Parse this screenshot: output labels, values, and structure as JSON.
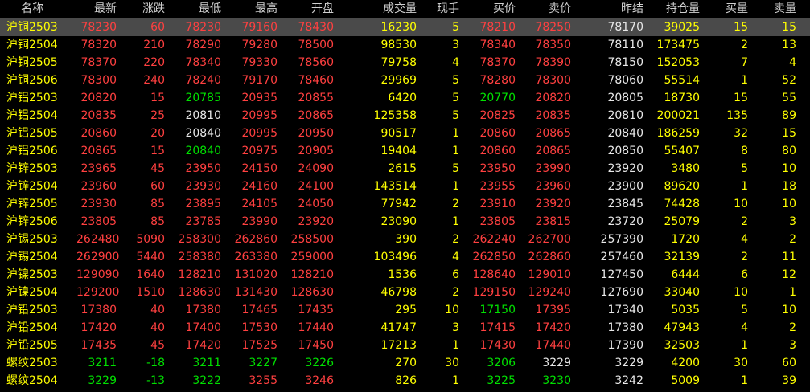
{
  "colors": {
    "red": "#ff4040",
    "green": "#00e000",
    "white": "#e8e8e8",
    "yellow": "#ffff00",
    "header": "#d0d0d0",
    "selected_row_bg": "#4a4a4a"
  },
  "headers": [
    "名称",
    "最新",
    "涨跌",
    "最低",
    "最高",
    "开盘",
    "成交量",
    "现手",
    "买价",
    "卖价",
    "昨结",
    "持仓量",
    "买量",
    "卖量"
  ],
  "rows": [
    {
      "cells": [
        "沪铜2503",
        "78230",
        "60",
        "78230",
        "79160",
        "78430",
        "16230",
        "5",
        "78210",
        "78250",
        "78170",
        "39025",
        "15",
        "15"
      ],
      "colors": [
        "y",
        "r",
        "r",
        "r",
        "r",
        "r",
        "y",
        "y",
        "r",
        "r",
        "w",
        "y",
        "y",
        "y"
      ]
    },
    {
      "cells": [
        "沪铜2504",
        "78320",
        "210",
        "78290",
        "79280",
        "78500",
        "98530",
        "3",
        "78340",
        "78350",
        "78110",
        "173475",
        "2",
        "13"
      ],
      "colors": [
        "y",
        "r",
        "r",
        "r",
        "r",
        "r",
        "y",
        "y",
        "r",
        "r",
        "w",
        "y",
        "y",
        "y"
      ]
    },
    {
      "cells": [
        "沪铜2505",
        "78370",
        "220",
        "78340",
        "79330",
        "78560",
        "79758",
        "4",
        "78370",
        "78390",
        "78150",
        "152053",
        "7",
        "4"
      ],
      "colors": [
        "y",
        "r",
        "r",
        "r",
        "r",
        "r",
        "y",
        "y",
        "r",
        "r",
        "w",
        "y",
        "y",
        "y"
      ]
    },
    {
      "cells": [
        "沪铜2506",
        "78300",
        "240",
        "78240",
        "79170",
        "78460",
        "29969",
        "5",
        "78280",
        "78300",
        "78060",
        "55514",
        "1",
        "52"
      ],
      "colors": [
        "y",
        "r",
        "r",
        "r",
        "r",
        "r",
        "y",
        "y",
        "r",
        "r",
        "w",
        "y",
        "y",
        "y"
      ]
    },
    {
      "cells": [
        "沪铝2503",
        "20820",
        "15",
        "20785",
        "20935",
        "20855",
        "6420",
        "5",
        "20770",
        "20820",
        "20805",
        "18730",
        "15",
        "55"
      ],
      "colors": [
        "y",
        "r",
        "r",
        "g",
        "r",
        "r",
        "y",
        "y",
        "g",
        "r",
        "w",
        "y",
        "y",
        "y"
      ]
    },
    {
      "cells": [
        "沪铝2504",
        "20835",
        "25",
        "20810",
        "20995",
        "20865",
        "125358",
        "5",
        "20825",
        "20835",
        "20810",
        "200021",
        "135",
        "89"
      ],
      "colors": [
        "y",
        "r",
        "r",
        "w",
        "r",
        "r",
        "y",
        "y",
        "r",
        "r",
        "w",
        "y",
        "y",
        "y"
      ]
    },
    {
      "cells": [
        "沪铝2505",
        "20860",
        "20",
        "20840",
        "20995",
        "20950",
        "90517",
        "1",
        "20860",
        "20865",
        "20840",
        "186259",
        "32",
        "15"
      ],
      "colors": [
        "y",
        "r",
        "r",
        "w",
        "r",
        "r",
        "y",
        "y",
        "r",
        "r",
        "w",
        "y",
        "y",
        "y"
      ]
    },
    {
      "cells": [
        "沪铝2506",
        "20865",
        "15",
        "20840",
        "20975",
        "20905",
        "19404",
        "1",
        "20860",
        "20865",
        "20850",
        "55407",
        "8",
        "80"
      ],
      "colors": [
        "y",
        "r",
        "r",
        "g",
        "r",
        "r",
        "y",
        "y",
        "r",
        "r",
        "w",
        "y",
        "y",
        "y"
      ]
    },
    {
      "cells": [
        "沪锌2503",
        "23965",
        "45",
        "23950",
        "24150",
        "24090",
        "2615",
        "5",
        "23950",
        "23990",
        "23920",
        "3480",
        "5",
        "10"
      ],
      "colors": [
        "y",
        "r",
        "r",
        "r",
        "r",
        "r",
        "y",
        "y",
        "r",
        "r",
        "w",
        "y",
        "y",
        "y"
      ]
    },
    {
      "cells": [
        "沪锌2504",
        "23960",
        "60",
        "23930",
        "24160",
        "24100",
        "143514",
        "1",
        "23955",
        "23960",
        "23900",
        "89620",
        "1",
        "18"
      ],
      "colors": [
        "y",
        "r",
        "r",
        "r",
        "r",
        "r",
        "y",
        "y",
        "r",
        "r",
        "w",
        "y",
        "y",
        "y"
      ]
    },
    {
      "cells": [
        "沪锌2505",
        "23930",
        "85",
        "23895",
        "24105",
        "24050",
        "77942",
        "2",
        "23910",
        "23920",
        "23845",
        "74428",
        "10",
        "10"
      ],
      "colors": [
        "y",
        "r",
        "r",
        "r",
        "r",
        "r",
        "y",
        "y",
        "r",
        "r",
        "w",
        "y",
        "y",
        "y"
      ]
    },
    {
      "cells": [
        "沪锌2506",
        "23805",
        "85",
        "23785",
        "23990",
        "23920",
        "23090",
        "1",
        "23805",
        "23815",
        "23720",
        "25079",
        "2",
        "3"
      ],
      "colors": [
        "y",
        "r",
        "r",
        "r",
        "r",
        "r",
        "y",
        "y",
        "r",
        "r",
        "w",
        "y",
        "y",
        "y"
      ]
    },
    {
      "cells": [
        "沪锡2503",
        "262480",
        "5090",
        "258300",
        "262860",
        "258500",
        "390",
        "2",
        "262240",
        "262700",
        "257390",
        "1720",
        "4",
        "2"
      ],
      "colors": [
        "y",
        "r",
        "r",
        "r",
        "r",
        "r",
        "y",
        "y",
        "r",
        "r",
        "w",
        "y",
        "y",
        "y"
      ]
    },
    {
      "cells": [
        "沪锡2504",
        "262900",
        "5440",
        "258380",
        "263380",
        "259000",
        "103496",
        "4",
        "262850",
        "262860",
        "257460",
        "32139",
        "2",
        "11"
      ],
      "colors": [
        "y",
        "r",
        "r",
        "r",
        "r",
        "r",
        "y",
        "y",
        "r",
        "r",
        "w",
        "y",
        "y",
        "y"
      ]
    },
    {
      "cells": [
        "沪镍2503",
        "129090",
        "1640",
        "128210",
        "131020",
        "128210",
        "1536",
        "6",
        "128640",
        "129010",
        "127450",
        "6444",
        "6",
        "12"
      ],
      "colors": [
        "y",
        "r",
        "r",
        "r",
        "r",
        "r",
        "y",
        "y",
        "r",
        "r",
        "w",
        "y",
        "y",
        "y"
      ]
    },
    {
      "cells": [
        "沪镍2504",
        "129200",
        "1510",
        "128630",
        "131430",
        "128630",
        "46798",
        "2",
        "129150",
        "129240",
        "127690",
        "33040",
        "10",
        "1"
      ],
      "colors": [
        "y",
        "r",
        "r",
        "r",
        "r",
        "r",
        "y",
        "y",
        "r",
        "r",
        "w",
        "y",
        "y",
        "y"
      ]
    },
    {
      "cells": [
        "沪铅2503",
        "17380",
        "40",
        "17380",
        "17465",
        "17435",
        "295",
        "10",
        "17150",
        "17395",
        "17340",
        "5035",
        "5",
        "10"
      ],
      "colors": [
        "y",
        "r",
        "r",
        "r",
        "r",
        "r",
        "y",
        "y",
        "g",
        "r",
        "w",
        "y",
        "y",
        "y"
      ]
    },
    {
      "cells": [
        "沪铅2504",
        "17420",
        "40",
        "17400",
        "17530",
        "17440",
        "41747",
        "3",
        "17415",
        "17420",
        "17380",
        "47943",
        "4",
        "2"
      ],
      "colors": [
        "y",
        "r",
        "r",
        "r",
        "r",
        "r",
        "y",
        "y",
        "r",
        "r",
        "w",
        "y",
        "y",
        "y"
      ]
    },
    {
      "cells": [
        "沪铅2505",
        "17435",
        "45",
        "17420",
        "17525",
        "17450",
        "17213",
        "1",
        "17430",
        "17440",
        "17390",
        "32503",
        "1",
        "3"
      ],
      "colors": [
        "y",
        "r",
        "r",
        "r",
        "r",
        "r",
        "y",
        "y",
        "r",
        "r",
        "w",
        "y",
        "y",
        "y"
      ]
    },
    {
      "cells": [
        "螺纹2503",
        "3211",
        "-18",
        "3211",
        "3227",
        "3226",
        "270",
        "30",
        "3206",
        "3229",
        "3229",
        "4200",
        "30",
        "60"
      ],
      "colors": [
        "y",
        "g",
        "g",
        "g",
        "g",
        "g",
        "y",
        "y",
        "g",
        "w",
        "w",
        "y",
        "y",
        "y"
      ]
    },
    {
      "cells": [
        "螺纹2504",
        "3229",
        "-13",
        "3222",
        "3255",
        "3246",
        "826",
        "1",
        "3225",
        "3230",
        "3242",
        "5009",
        "1",
        "39"
      ],
      "colors": [
        "y",
        "g",
        "g",
        "g",
        "r",
        "r",
        "y",
        "y",
        "g",
        "g",
        "w",
        "y",
        "y",
        "y"
      ]
    }
  ]
}
